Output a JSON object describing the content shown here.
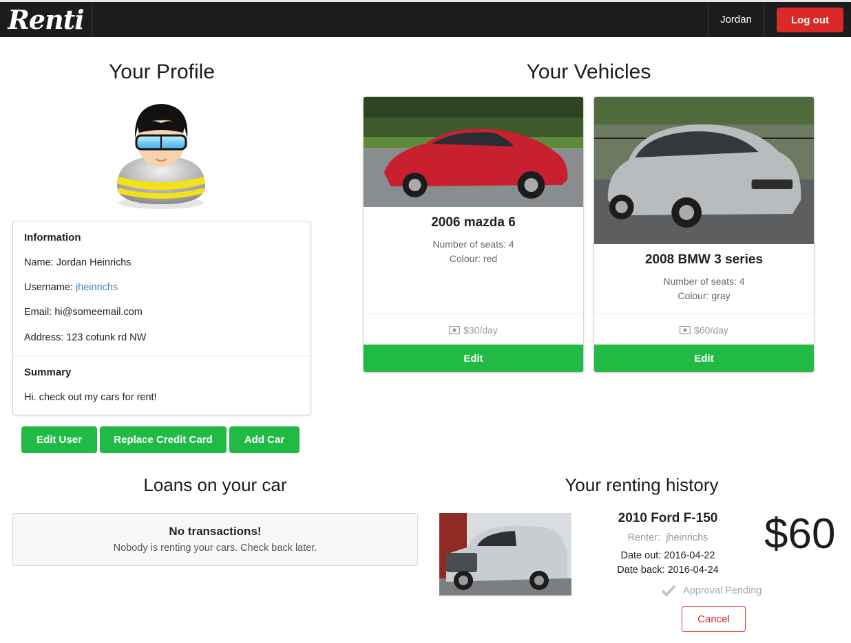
{
  "navbar": {
    "brand": "Renti",
    "username": "Jordan",
    "logout_label": "Log out"
  },
  "profile": {
    "title": "Your Profile",
    "avatar_icon": "user-goggles-avatar",
    "info_heading": "Information",
    "name_label": "Name:",
    "name": "Jordan Heinrichs",
    "username_label": "Username:",
    "username": "jheinrichs",
    "email_label": "Email:",
    "email": "hi@someemail.com",
    "address_label": "Address:",
    "address": "123 cotunk rd NW",
    "summary_heading": "Summary",
    "summary": "Hi. check out my cars for rent!",
    "buttons": {
      "edit_user": "Edit User",
      "replace_card": "Replace Credit Card",
      "add_car": "Add Car"
    }
  },
  "vehicles": {
    "title": "Your Vehicles",
    "items": [
      {
        "name": "2006 mazda 6",
        "seats": "Number of seats: 4",
        "colour": "Colour: red",
        "price": "$30/day",
        "edit_label": "Edit",
        "photo_color": "#c8202e"
      },
      {
        "name": "2008 BMW 3 series",
        "seats": "Number of seats: 4",
        "colour": "Colour: gray",
        "price": "$60/day",
        "edit_label": "Edit",
        "photo_color": "#b9bcbf"
      }
    ]
  },
  "loans": {
    "title": "Loans on your car",
    "empty_title": "No transactions!",
    "empty_text": "Nobody is renting your cars. Check back later."
  },
  "history": {
    "title": "Your renting history",
    "vehicle": "2010 Ford F-150",
    "renter_label": "Renter:",
    "renter": "jheinrichs",
    "date_out": "Date out: 2016-04-22",
    "date_back": "Date back: 2016-04-24",
    "price": "$60",
    "status": "Approval Pending",
    "cancel_label": "Cancel"
  },
  "colors": {
    "navbar": "#1b1c1d",
    "danger": "#db2828",
    "success": "#21ba45",
    "link": "#4183c4"
  }
}
